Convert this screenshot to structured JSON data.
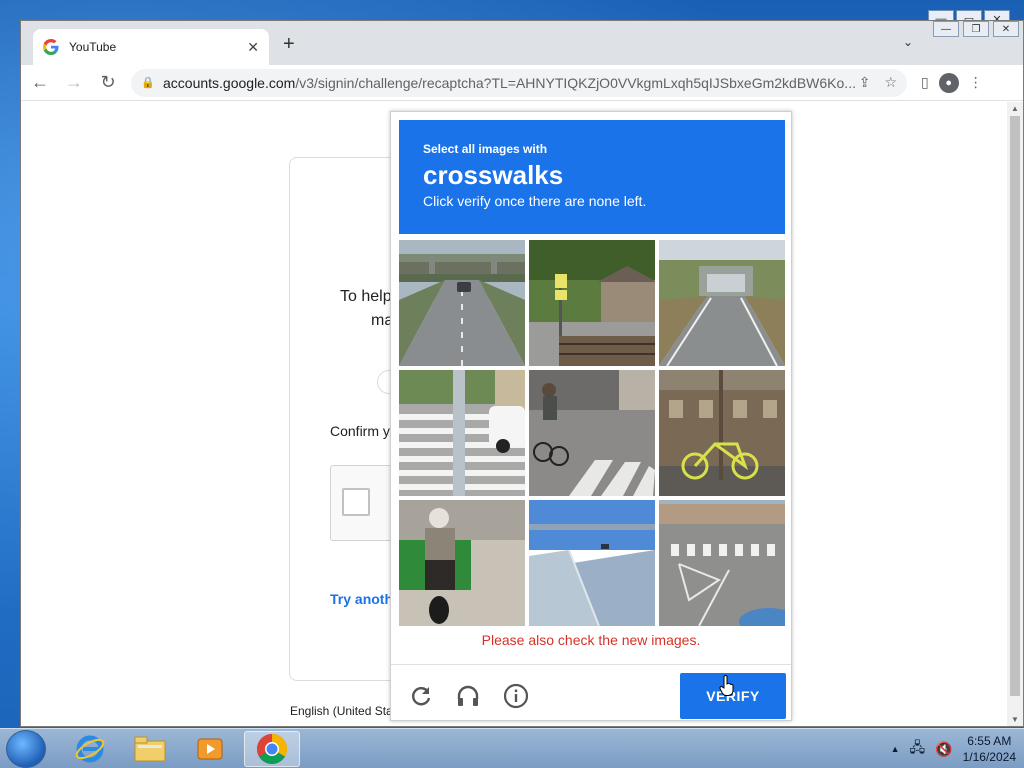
{
  "browser": {
    "tab_title": "YouTube",
    "tab_close": "✕",
    "new_tab": "+",
    "url_domain": "accounts.google.com",
    "url_path": "/v3/signin/challenge/recaptcha?TL=AHNYTIQKZjO0VVkgmLxqh5qIJSbxeGm2kdBW6Ko..."
  },
  "background_page": {
    "text_line1": "To help",
    "text_line2": "ma",
    "confirm_text": "Confirm y",
    "try_another": "Try anoth",
    "language": "English (United Sta"
  },
  "captcha": {
    "instruction_small": "Select all images with",
    "instruction_keyword": "crosswalks",
    "instruction_sub": "Click verify once there are none left.",
    "error": "Please also check the new images.",
    "verify_label": "VERIFY"
  },
  "taskbar": {
    "time": "6:55 AM",
    "date": "1/16/2024"
  },
  "colors": {
    "accent": "#1a73e8",
    "error": "#d93025"
  }
}
